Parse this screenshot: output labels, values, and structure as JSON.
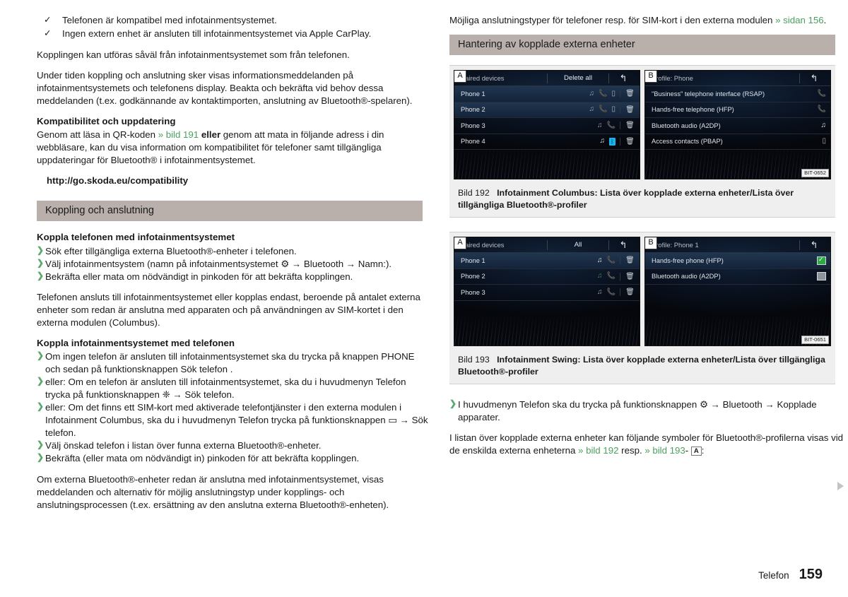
{
  "left": {
    "checks": [
      "Telefonen är kompatibel med infotainmentsystemet.",
      "Ingen extern enhet är ansluten till infotainmentsystemet via Apple CarPlay."
    ],
    "para1": "Kopplingen kan utföras såväl från infotainmentsystemet som från telefonen.",
    "para2": "Under tiden koppling och anslutning sker visas informationsmeddelanden på infotainmentsystemets och telefonens display. Beakta och bekräfta vid behov dessa meddelanden (t.ex. godkännande av kontaktimporten, anslutning av Bluetooth®-spelaren).",
    "subhead_compat": "Kompatibilitet och uppdatering",
    "compat_para_1": "Genom att läsa in QR-koden",
    "compat_link": "» bild 191",
    "compat_bold": "eller",
    "compat_para_2": "genom att mata in följande adress i din webbläsare, kan du visa information om kompatibilitet för telefoner samt tillgängliga uppdateringar för Bluetooth® i infotainmentsystemet.",
    "url": "http://go.skoda.eu/compatibility",
    "band": "Koppling och anslutning",
    "subhead_pair_phone": "Koppla telefonen med infotainmentsystemet",
    "bullets_pair_phone": [
      "Sök efter tillgängliga externa Bluetooth®-enheter i telefonen.",
      "Välj infotainmentsystem (namn på infotainmentsystemet ⚙ → Bluetooth → Namn:).",
      "Bekräfta eller mata om nödvändigt in pinkoden för att bekräfta kopplingen."
    ],
    "para3": "Telefonen ansluts till infotainmentsystemet eller kopplas endast, beroende på antalet externa enheter som redan är anslutna med apparaten och på användningen av SIM-kortet i den externa modulen (Columbus).",
    "subhead_pair_infot": "Koppla infotainmentsystemet med telefonen",
    "bullets_pair_infot": [
      "Om ingen telefon är ansluten till infotainmentsystemet ska du trycka på knappen PHONE och sedan på funktionsknappen Sök telefon .",
      "eller: Om en telefon är ansluten till infotainmentsystemet, ska du i huvudmenyn Telefon trycka på funktionsknappen ❈ → Sök telefon.",
      "eller: Om det finns ett SIM-kort med aktiverade telefontjänster i den externa modulen i Infotainment Columbus, ska du i huvudmenyn Telefon trycka på funktionsknappen ▭ → Sök telefon.",
      "Välj önskad telefon i listan över funna externa Bluetooth®-enheter.",
      "Bekräfta (eller mata om nödvändigt in) pinkoden för att bekräfta kopplingen."
    ],
    "keycap_phone": "PHONE",
    "para4": "Om externa Bluetooth®-enheter redan är anslutna med infotainmentsystemet, visas meddelanden och alternativ för möjlig anslutningstyp under kopplings- och anslutningsprocessen (t.ex. ersättning av den anslutna externa Bluetooth®-enheten)."
  },
  "right": {
    "intro_text": "Möjliga anslutningstyper för telefoner resp. för SIM-kort i den externa modulen",
    "intro_link": "» sidan 156",
    "band": "Hantering av kopplade externa enheter",
    "figure192": {
      "badge_a": "A",
      "badge_b": "B",
      "bitcode": "BIT-0652",
      "caption_num": "Bild 192",
      "caption_text": "Infotainment Columbus: Lista över kopplade externa enheter/Lista över tillgängliga Bluetooth®-profiler",
      "screen_a": {
        "title": "Paired devices",
        "action": "Delete all",
        "back_icon": "back-arrow-icon",
        "rows": [
          {
            "label": "Phone 1",
            "icons": [
              "note-dim",
              "phone-dim",
              "contacts-dim"
            ],
            "trash": "trash-icon",
            "highlight": true
          },
          {
            "label": "Phone 2",
            "icons": [
              "note-dim",
              "phone-dim",
              "contacts-dim"
            ],
            "trash": "trash-icon",
            "highlight": true
          },
          {
            "label": "Phone 3",
            "icons": [
              "note-dim",
              "phone-green"
            ],
            "trash": "trash-icon",
            "highlight": false
          },
          {
            "label": "Phone 4",
            "icons": [
              "note-white",
              "bt-on"
            ],
            "trash": "trash-icon",
            "highlight": false
          }
        ]
      },
      "screen_b": {
        "title": "Profile: Phone",
        "action": "",
        "back_icon": "back-arrow-icon",
        "rows": [
          {
            "label": "\"Business\" telephone interface (RSAP)",
            "icons": [
              "phone-dim"
            ],
            "highlight": false
          },
          {
            "label": "Hands-free telephone (HFP)",
            "icons": [
              "phone-green"
            ],
            "highlight": false
          },
          {
            "label": "Bluetooth audio (A2DP)",
            "icons": [
              "note-white"
            ],
            "highlight": false
          },
          {
            "label": "Access contacts (PBAP)",
            "icons": [
              "contacts-dim"
            ],
            "highlight": false
          }
        ]
      }
    },
    "figure193": {
      "badge_a": "A",
      "badge_b": "B",
      "bitcode": "BIT-0651",
      "caption_num": "Bild 193",
      "caption_text": "Infotainment Swing: Lista över kopplade externa enheter/Lista över tillgängliga Bluetooth®-profiler",
      "screen_a": {
        "title": "Paired devices",
        "action": "All",
        "back_icon": "back-arrow-icon",
        "rows": [
          {
            "label": "Phone 1",
            "icons": [
              "note-white",
              "phone-green"
            ],
            "trash": "trash-icon",
            "highlight": true
          },
          {
            "label": "Phone 2",
            "icons": [
              "note-green",
              "phone-white"
            ],
            "trash": "trash-icon",
            "highlight": false
          },
          {
            "label": "Phone 3",
            "icons": [
              "note-dim",
              "phone-white"
            ],
            "trash": "trash-icon",
            "highlight": false
          }
        ]
      },
      "screen_b": {
        "title": "Profile: Phone 1",
        "action": "",
        "back_icon": "back-arrow-icon",
        "rows": [
          {
            "label": "Hands-free phone (HFP)",
            "check": "on",
            "highlight": true
          },
          {
            "label": "Bluetooth audio (A2DP)",
            "check": "off",
            "highlight": false
          }
        ]
      }
    },
    "bullet_menu": "I huvudmenyn Telefon ska du trycka på funktionsknappen ⚙ → Bluetooth → Kopplade apparater.",
    "closing_1": "I listan över kopplade externa enheter kan följande symboler för Bluetooth®-profilerna visas vid de enskilda externa enheterna",
    "closing_link_1": "» bild 192",
    "closing_mid": "resp.",
    "closing_link_2": "» bild 193",
    "closing_tail": "-",
    "closing_ref": "A",
    "closing_colon": ":"
  },
  "footer": {
    "section": "Telefon",
    "page": "159"
  },
  "colors": {
    "link_green": "#4aa05f",
    "band_gray": "#b9b0ac",
    "figure_bg": "#f0efef",
    "text": "#1a1a1a",
    "screen_bg": "#0a1322",
    "accent_green": "#33b14b",
    "bt_blue": "#17b6ef"
  }
}
